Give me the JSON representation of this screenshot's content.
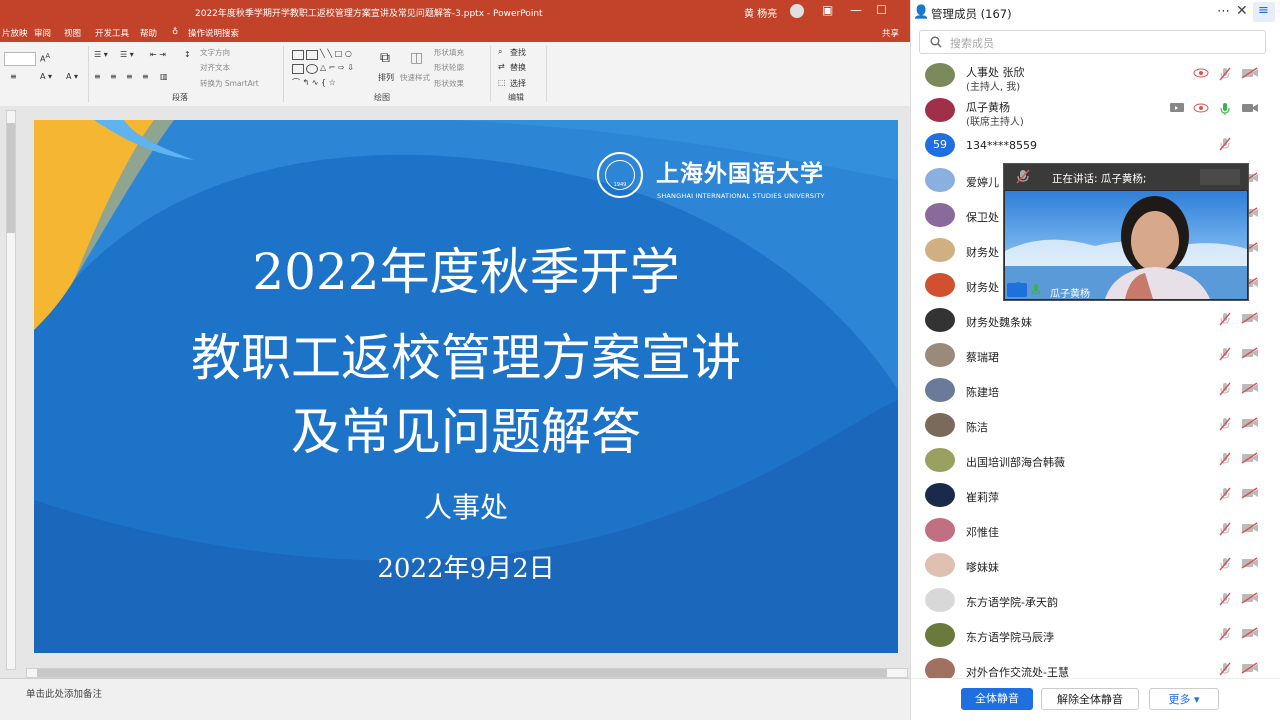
{
  "ppt": {
    "window_title": "2022年度秋季学期开学教职工返校管理方案宣讲及常见问题解答-3.pptx - PowerPoint",
    "user_name": "黄 杨亮",
    "menu": [
      "片放映",
      "审阅",
      "视图",
      "开发工具",
      "帮助",
      "操作说明搜索"
    ],
    "share_label": "共享",
    "ribbon": {
      "text_direction": "文字方向",
      "align_text": "对齐文本",
      "convert_smartart": "转换为 SmartArt",
      "arrange": "排列",
      "quick_styles": "快速样式",
      "shape_fill": "形状填充",
      "shape_outline": "形状轮廓",
      "shape_effects": "形状效果",
      "find": "查找",
      "replace": "替换",
      "select": "选择",
      "group_paragraph": "段落",
      "group_drawing": "绘图",
      "group_editing": "编辑"
    },
    "notes_placeholder": "单击此处添加备注"
  },
  "slide": {
    "logo_cn": "上海外国语大学",
    "logo_en": "SHANGHAI INTERNATIONAL STUDIES UNIVERSITY",
    "logo_year": "1949",
    "title_line1": "2022年度秋季开学",
    "title_line2": "教职工返校管理方案宣讲",
    "title_line3": "及常见问题解答",
    "department": "人事处",
    "date": "2022年9月2日",
    "colors": {
      "background": "#1d73c8",
      "accent_yellow": "#f5b731",
      "light_blue": "#5fb3ee"
    }
  },
  "panel": {
    "title": "管理成员 (167)",
    "search_placeholder": "搜索成员",
    "members": [
      {
        "name": "人事处 张欣",
        "role": "(主持人, 我)",
        "avatar": "#7a8a5a"
      },
      {
        "name": "瓜子黄杨",
        "role": "(联席主持人)",
        "avatar": "#a0304a"
      },
      {
        "name": "134****8559",
        "role": "",
        "avatar": "#1f6fe0",
        "avatar_text": "59"
      },
      {
        "name": "爱婷儿",
        "role": "",
        "avatar": "#8ab0e0"
      },
      {
        "name": "保卫处",
        "role": "",
        "avatar": "#8a6a9a"
      },
      {
        "name": "财务处",
        "role": "",
        "avatar": "#d0b080"
      },
      {
        "name": "财务处",
        "role": "",
        "avatar": "#d05030"
      },
      {
        "name": "财务处魏条妹",
        "role": "",
        "avatar": "#333333"
      },
      {
        "name": "蔡瑞珺",
        "role": "",
        "avatar": "#9a8a7a"
      },
      {
        "name": "陈建培",
        "role": "",
        "avatar": "#6a7a9a"
      },
      {
        "name": "陈洁",
        "role": "",
        "avatar": "#7a6a5a"
      },
      {
        "name": "出国培训部海合韩薇",
        "role": "",
        "avatar": "#9aa060"
      },
      {
        "name": "崔莉萍",
        "role": "",
        "avatar": "#1a2a4a"
      },
      {
        "name": "邓惟佳",
        "role": "",
        "avatar": "#c07080"
      },
      {
        "name": "嗲妹妹",
        "role": "",
        "avatar": "#e0c0b0"
      },
      {
        "name": "东方语学院-承天韵",
        "role": "",
        "avatar": "#d8d8d8"
      },
      {
        "name": "东方语学院马辰浡",
        "role": "",
        "avatar": "#6a7a3a"
      },
      {
        "name": "对外合作交流处-王慧",
        "role": "",
        "avatar": "#a07060"
      }
    ],
    "buttons": {
      "mute_all": "全体静音",
      "unmute_all": "解除全体静音",
      "more": "更多 ▾"
    }
  },
  "video": {
    "speaking": "正在讲话: 瓜子黄杨;",
    "name": "瓜子黄杨"
  },
  "colors": {
    "ppt_red": "#c3432a",
    "primary_blue": "#1f6fe0",
    "mic_muted": "#d9534f",
    "mic_on": "#3cb34a"
  }
}
